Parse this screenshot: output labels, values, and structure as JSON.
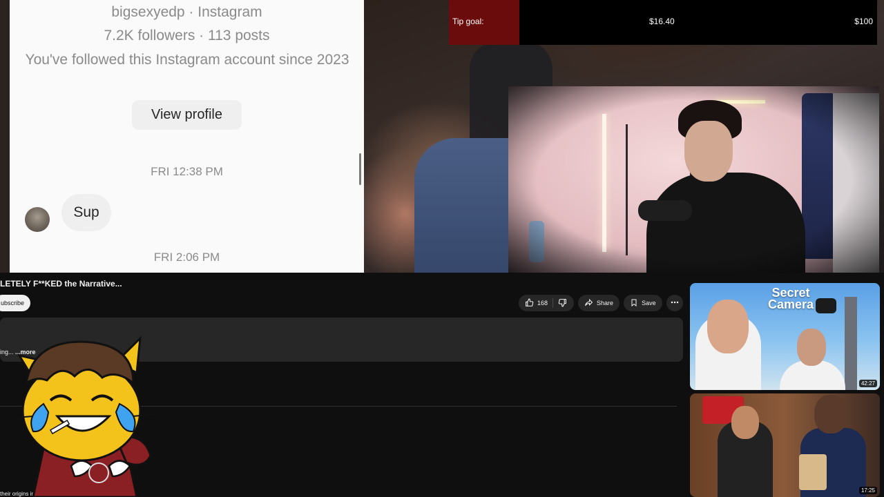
{
  "instagram": {
    "handle": "bigsexyedp · Instagram",
    "followers": "7.2K followers · 113 posts",
    "since": "You've followed this Instagram account since 2023",
    "view_profile": "View profile",
    "time1": "FRI 12:38 PM",
    "message": "Sup",
    "time2": "FRI 2:06 PM"
  },
  "tip": {
    "label": "Tip goal:",
    "current": "$16.40",
    "goal": "$100",
    "progress": 0.164,
    "fill_color": "#6a0c0c"
  },
  "video": {
    "title": "LETELY F**KED the Narrative...",
    "subscribe": "ubscribe",
    "likes": "168",
    "share": "Share",
    "save": "Save",
    "desc_snippet": "ing...",
    "more": "...more",
    "bottom_text": "their origins in \"Pranks"
  },
  "recommendations": [
    {
      "thumb_text": "Secret Camera",
      "duration": "42:27"
    },
    {
      "thumb_text": "",
      "duration": "17:25"
    }
  ],
  "icons": {
    "like": "thumbs-up-icon",
    "dislike": "thumbs-down-icon",
    "share": "share-arrow-icon",
    "save": "bookmark-icon",
    "more": "more-dots-icon"
  },
  "colors": {
    "page_bg": "#0f0f0f",
    "pill_bg": "#272727",
    "instagram_bg": "#fafafa"
  }
}
